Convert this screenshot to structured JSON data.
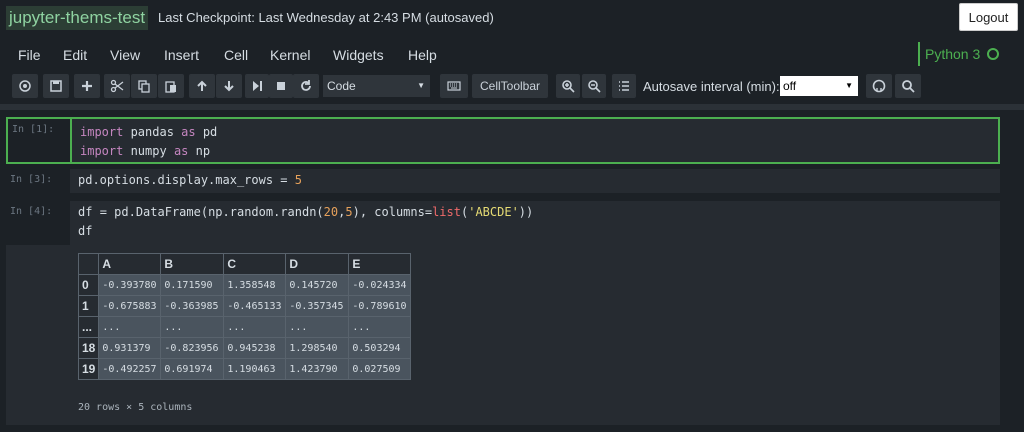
{
  "header": {
    "notebook_name": "jupyter-thems-test",
    "checkpoint": "Last Checkpoint: Last Wednesday at 2:43 PM (autosaved)",
    "logout_label": "Logout"
  },
  "menu": [
    "File",
    "Edit",
    "View",
    "Insert",
    "Cell",
    "Kernel",
    "Widgets",
    "Help"
  ],
  "kernel": {
    "name": "Python 3",
    "status_icon": "circle-idle-icon",
    "color": "#4caf50"
  },
  "toolbar": {
    "cell_type": "Code",
    "celltoolbar_label": "CellToolbar",
    "autosave_label": "Autosave interval (min):",
    "autosave_value": "off"
  },
  "cells": [
    {
      "prompt": "In [1]:"
    },
    {
      "prompt": "In [3]:"
    },
    {
      "prompt": "In [4]:"
    }
  ],
  "output": {
    "columns": [
      "",
      "A",
      "B",
      "C",
      "D",
      "E"
    ],
    "rows": [
      {
        "index": "0",
        "values": [
          "-0.393780",
          "0.171590",
          "1.358548",
          "0.145720",
          "-0.024334"
        ]
      },
      {
        "index": "1",
        "values": [
          "-0.675883",
          "-0.363985",
          "-0.465133",
          "-0.357345",
          "-0.789610"
        ]
      },
      {
        "index": "...",
        "values": [
          "...",
          "...",
          "...",
          "...",
          "..."
        ]
      },
      {
        "index": "18",
        "values": [
          "0.931379",
          "-0.823956",
          "0.945238",
          "1.298540",
          "0.503294"
        ]
      },
      {
        "index": "19",
        "values": [
          "-0.492257",
          "0.691974",
          "1.190463",
          "1.423790",
          "0.027509"
        ]
      }
    ],
    "row_count": "20 rows × 5 columns"
  },
  "colors": {
    "accent": "#4caf50",
    "background": "#1c2126",
    "cell_bg": "#262b31"
  }
}
